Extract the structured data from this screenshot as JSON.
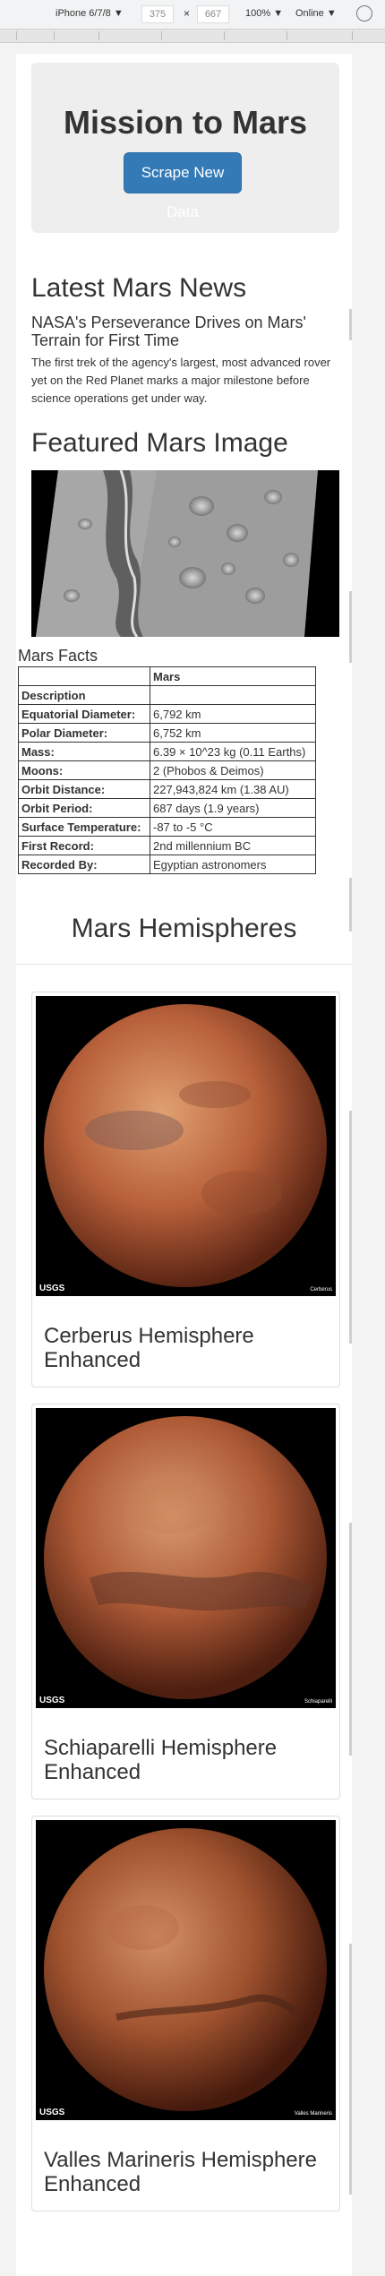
{
  "devtools": {
    "device": "iPhone 6/7/8 ▼",
    "width": "375",
    "x": "×",
    "height": "667",
    "zoom": "100% ▼",
    "network": "Online ▼"
  },
  "header": {
    "title": "Mission to Mars",
    "scrape_button": "Scrape New Data"
  },
  "news": {
    "section_title": "Latest Mars News",
    "headline": "NASA's Perseverance Drives on Mars' Terrain for First Time",
    "body": "The first trek of the agency's largest, most advanced rover yet on the Red Planet marks a major milestone before science operations get under way."
  },
  "featured": {
    "section_title": "Featured Mars Image"
  },
  "facts": {
    "caption": "Mars Facts",
    "column_header": "Mars",
    "rows": [
      {
        "label": "Description",
        "value": ""
      },
      {
        "label": "Equatorial Diameter:",
        "value": "6,792 km"
      },
      {
        "label": "Polar Diameter:",
        "value": "6,752 km"
      },
      {
        "label": "Mass:",
        "value": "6.39 × 10^23 kg (0.11 Earths)"
      },
      {
        "label": "Moons:",
        "value": "2 (Phobos & Deimos)"
      },
      {
        "label": "Orbit Distance:",
        "value": "227,943,824 km (1.38 AU)"
      },
      {
        "label": "Orbit Period:",
        "value": "687 days (1.9 years)"
      },
      {
        "label": "Surface Temperature:",
        "value": "-87 to -5 °C"
      },
      {
        "label": "First Record:",
        "value": "2nd millennium BC"
      },
      {
        "label": "Recorded By:",
        "value": "Egyptian astronomers"
      }
    ]
  },
  "hemispheres": {
    "section_title": "Mars Hemispheres",
    "items": [
      {
        "title": "Cerberus Hemisphere Enhanced",
        "logo": "USGS",
        "credit": "Cerberus",
        "color": "#c0693e"
      },
      {
        "title": "Schiaparelli Hemisphere Enhanced",
        "logo": "USGS",
        "credit": "Schiaparelli",
        "color": "#b5603a"
      },
      {
        "title": "Valles Marineris Hemisphere Enhanced",
        "logo": "USGS",
        "credit": "Valles Marineris",
        "color": "#a65a36"
      }
    ]
  }
}
